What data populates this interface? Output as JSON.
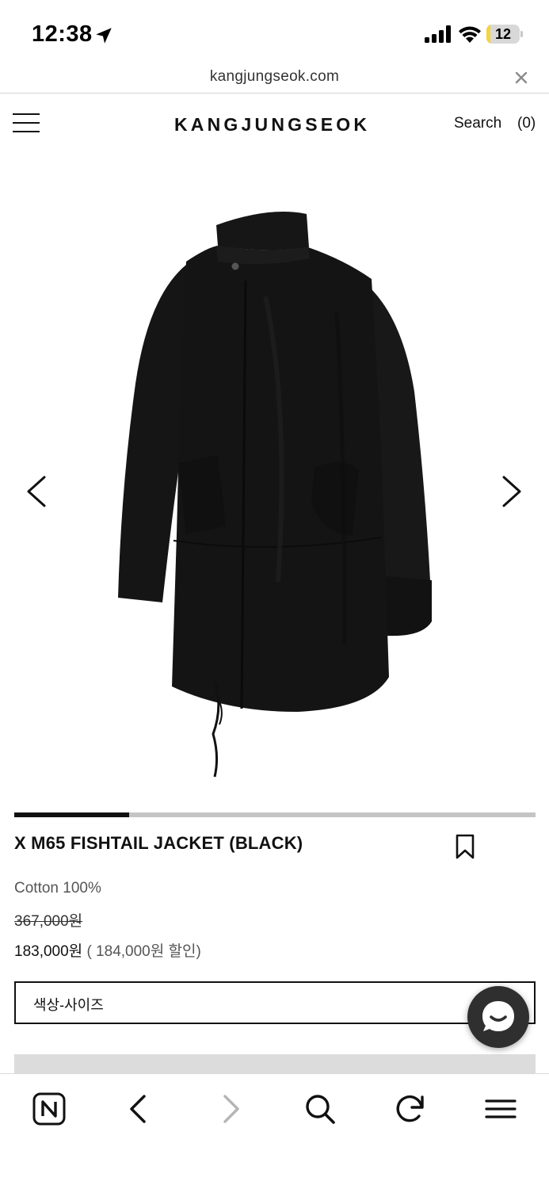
{
  "status_bar": {
    "time": "12:38",
    "battery_level": "12",
    "battery_fraction": 0.12
  },
  "browser": {
    "url": "kangjungseok.com"
  },
  "header": {
    "logo": "KANGJUNGSEOK",
    "search_label": "Search",
    "cart_label": "(0)"
  },
  "gallery": {
    "image_description_icon": "jacket-image",
    "progress_fraction": 0.22
  },
  "product": {
    "title": "X M65 FISHTAIL JACKET (BLACK)",
    "material": "Cotton 100%",
    "original_price": "367,000원",
    "sale_price": "183,000원",
    "discount_text": " ( 184,000원 할인)",
    "option_label": "색상-사이즈"
  },
  "colors": {
    "accent": "#111111",
    "progress_track": "#c4c4c4",
    "chat_button": "#2f2f2f",
    "battery_fill": "#f6d43b"
  }
}
